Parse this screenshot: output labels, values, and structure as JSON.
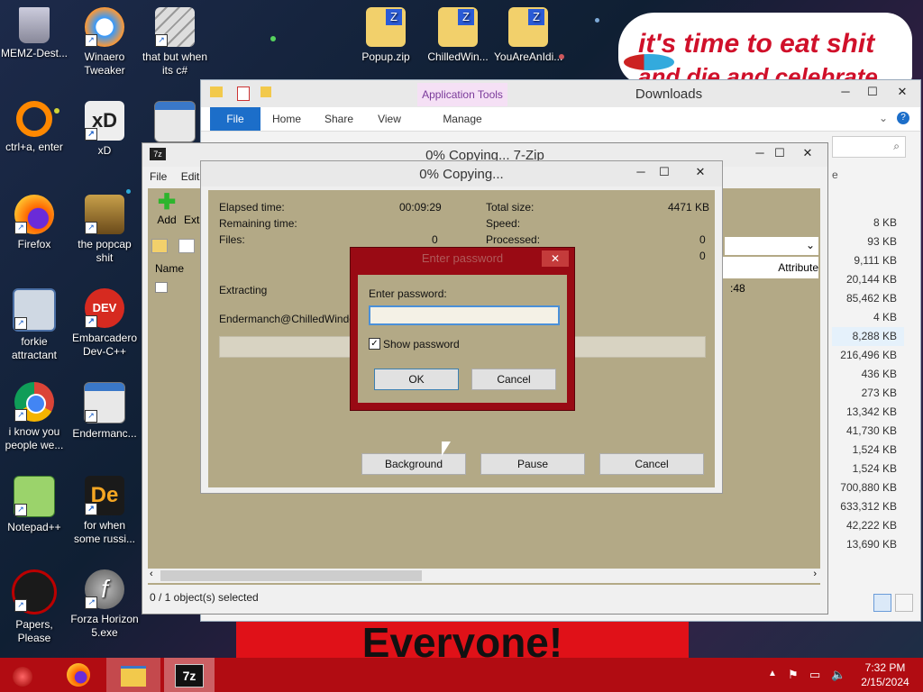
{
  "desktop_icons": [
    {
      "label": "MEMZ-Dest...",
      "icon": "recycle-bin-icon"
    },
    {
      "label": "Winaero Tweaker",
      "icon": "winaero-icon"
    },
    {
      "label": "that but when its c#",
      "icon": "stacked-windows-icon"
    },
    {
      "label": "Popup.zip",
      "icon": "zip-folder-icon"
    },
    {
      "label": "ChilledWin...",
      "icon": "zip-folder-icon"
    },
    {
      "label": "YouAreAnIdi...",
      "icon": "zip-folder-icon"
    },
    {
      "label": "ctrl+a, enter",
      "icon": "orange-ring-icon"
    },
    {
      "label": "xD",
      "icon": "hxd-icon"
    },
    {
      "label": "Firefox",
      "icon": "firefox-icon"
    },
    {
      "label": "the popcap shit",
      "icon": "popcap-icon"
    },
    {
      "label": "forkie attractant",
      "icon": "monitor-gear-icon"
    },
    {
      "label": "Embarcadero Dev-C++",
      "icon": "devcpp-icon"
    },
    {
      "label": "i know you people we...",
      "icon": "chrome-icon"
    },
    {
      "label": "Endermanc...",
      "icon": "window-icon"
    },
    {
      "label": "Notepad++",
      "icon": "notepadpp-icon"
    },
    {
      "label": "for when some russi...",
      "icon": "de-icon"
    },
    {
      "label": "Papers, Please",
      "icon": "papers-please-icon"
    },
    {
      "label": "Forza Horizon 5.exe",
      "icon": "flash-icon"
    }
  ],
  "banner_text": "it's time to eat shit",
  "banner_text_2": "and die and celebrate",
  "bottom_banner_text": "Everyone!",
  "explorer": {
    "title": "Downloads",
    "tools_tab": "Application Tools",
    "tabs": [
      "File",
      "Home",
      "Share",
      "View",
      "Manage"
    ],
    "column_header": "Attribute",
    "column_header_partial": "e",
    "sizes": [
      "8 KB",
      "93 KB",
      "9,111 KB",
      "20,144 KB",
      "85,462 KB",
      "4 KB",
      "8,288 KB",
      "216,496 KB",
      "436 KB",
      "273 KB",
      "13,342 KB",
      "41,730 KB",
      "1,524 KB",
      "1,524 KB",
      "700,880 KB",
      "633,312 KB",
      "42,222 KB",
      "13,690 KB"
    ]
  },
  "zip_manager": {
    "title": "0% Copying... 7-Zip",
    "menu": [
      "File",
      "Edit"
    ],
    "toolbar": [
      "Add",
      "Ext"
    ],
    "column_name": "Name",
    "status": "0 / 1 object(s) selected",
    "partial_time": ":48"
  },
  "copy_dialog": {
    "title": "0% Copying...",
    "elapsed_label": "Elapsed time:",
    "elapsed_value": "00:09:29",
    "remaining_label": "Remaining time:",
    "files_label": "Files:",
    "files_value": "0",
    "total_size_label": "Total size:",
    "total_size_value": "4471 KB",
    "speed_label": "Speed:",
    "processed_label": "Processed:",
    "processed_value": "0",
    "extra_value": "0",
    "action": "Extracting",
    "path": "Endermanch@ChilledWindows",
    "progress": 0,
    "buttons": {
      "background": "Background",
      "pause": "Pause",
      "cancel": "Cancel"
    }
  },
  "password_dialog": {
    "title": "Enter password",
    "prompt": "Enter password:",
    "value": "",
    "show_password_label": "Show password",
    "show_password_checked": true,
    "ok": "OK",
    "cancel": "Cancel"
  },
  "taskbar": {
    "time": "7:32 PM",
    "date": "2/15/2024"
  },
  "colors": {
    "taskbar": "#b10c12",
    "dialog_body": "#b3a986",
    "password_frame": "#990a14",
    "ribbon_file": "#1c6ec9"
  }
}
